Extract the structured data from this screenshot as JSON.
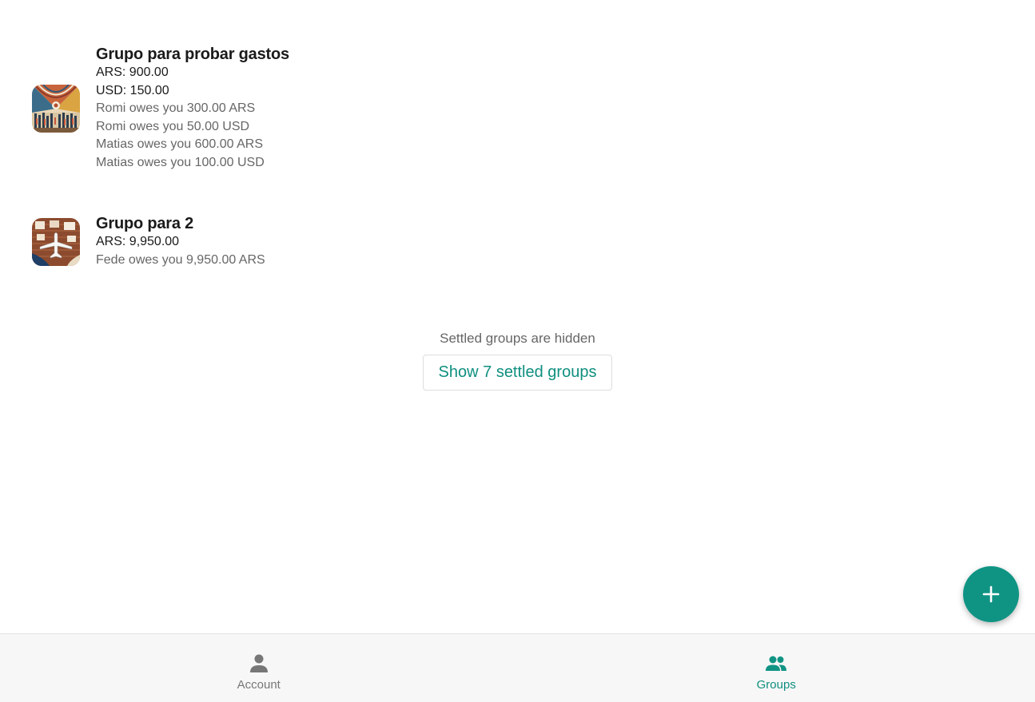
{
  "groups": [
    {
      "name": "Grupo para probar gastos",
      "balances": [
        "ARS: 900.00",
        "USD: 150.00"
      ],
      "debts": [
        "Romi owes you 300.00 ARS",
        "Romi owes you 50.00 USD",
        "Matias owes you 600.00 ARS",
        "Matias owes you 100.00 USD"
      ],
      "avatar_icon": "abstract-painting-image"
    },
    {
      "name": "Grupo para 2",
      "balances": [
        "ARS: 9,950.00"
      ],
      "debts": [
        "Fede owes you 9,950.00 ARS"
      ],
      "avatar_icon": "airplane-map-image"
    }
  ],
  "settled": {
    "note": "Settled groups are hidden",
    "button_label": "Show 7 settled groups"
  },
  "fab": {
    "icon": "plus-icon"
  },
  "nav": {
    "account": {
      "label": "Account",
      "icon": "person-icon"
    },
    "groups": {
      "label": "Groups",
      "icon": "people-icon"
    }
  },
  "colors": {
    "accent": "#0f9484",
    "accent_text": "#0f8f7f",
    "inactive": "#777777",
    "nav_bg": "#f7f7f7"
  }
}
